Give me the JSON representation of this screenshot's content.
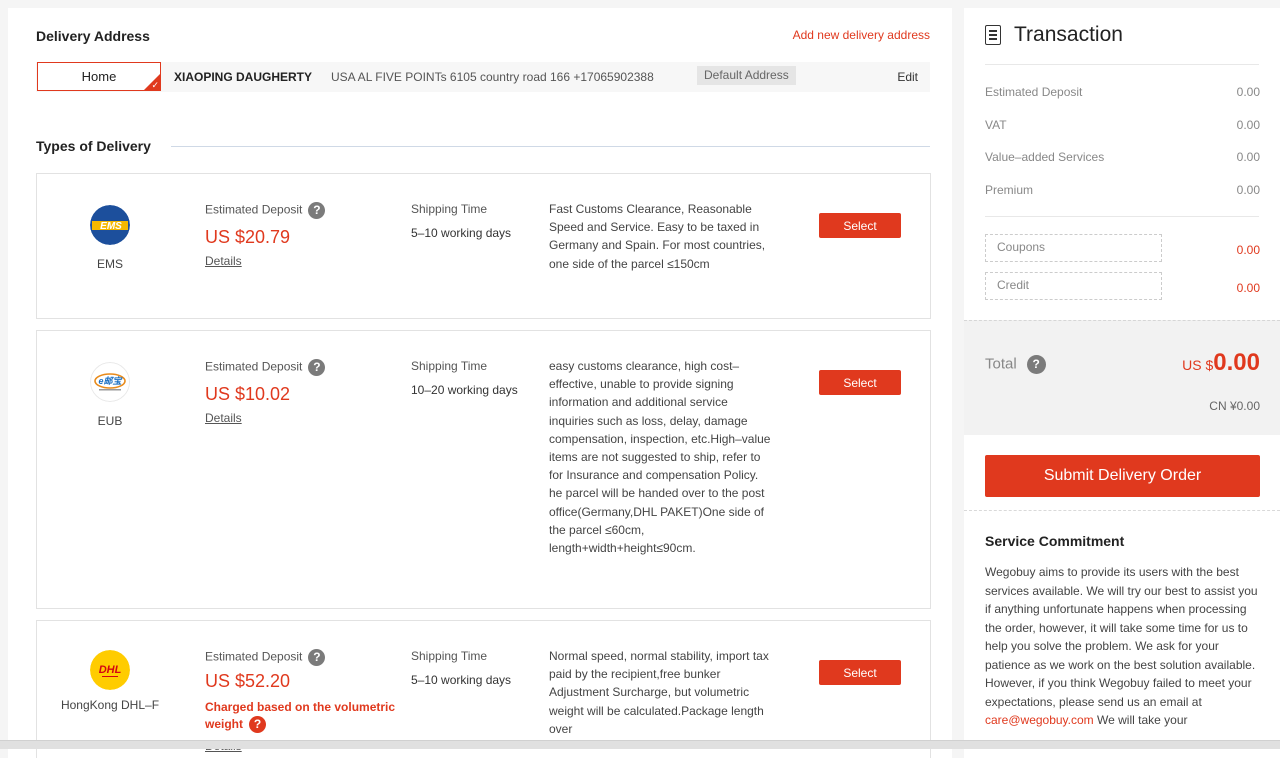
{
  "delivery_address": {
    "title": "Delivery Address",
    "add_link": "Add new delivery address",
    "tag": "Home",
    "name": "XIAOPING DAUGHERTY",
    "address": "USA AL FIVE POINTs 6105 country road 166 +17065902388",
    "badge": "Default Address",
    "edit": "Edit"
  },
  "types_title": "Types of Delivery",
  "deposit_label": "Estimated Deposit",
  "shipping_label": "Shipping Time",
  "details_label": "Details",
  "select_label": "Select",
  "options": [
    {
      "logo_icon": "ems-logo-icon",
      "name": "EMS",
      "price": "US $20.79",
      "time": "5–10 working days",
      "desc": "Fast Customs Clearance, Reasonable Speed and Service. Easy to be taxed in Germany and Spain. For most countries, one side of the parcel ≤150cm"
    },
    {
      "logo_icon": "eub-logo-icon",
      "name": "EUB",
      "price": "US $10.02",
      "time": "10–20 working days",
      "desc": "easy customs clearance, high cost–effective, unable to provide signing information and additional service inquiries such as loss, delay, damage compensation, inspection, etc.High–value items are not suggested to ship, refer to for Insurance and compensation Policy. he parcel will be handed over to the post office(Germany,DHL PAKET)One side of the parcel ≤60cm, length+width+height≤90cm."
    },
    {
      "logo_icon": "dhl-logo-icon",
      "name": "HongKong DHL–F",
      "price": "US $52.20",
      "time": "5–10 working days",
      "note": "Charged based on the volumetric weight",
      "desc": "Normal speed, normal stability, import tax paid by the recipient,free bunker Adjustment Surcharge, but volumetric weight will be calculated.Package length over"
    }
  ],
  "transaction": {
    "title": "Transaction",
    "rows": [
      {
        "label": "Estimated Deposit",
        "value": "0.00"
      },
      {
        "label": "VAT",
        "value": "0.00"
      },
      {
        "label": "Value–added Services",
        "value": "0.00"
      },
      {
        "label": "Premium",
        "value": "0.00"
      }
    ],
    "coupons_label": "Coupons",
    "coupons_value": "0.00",
    "credit_label": "Credit",
    "credit_value": "0.00",
    "total_label": "Total",
    "total_currency": "US $",
    "total_amount": "0.00",
    "total_cny": "CN ¥0.00",
    "submit_label": "Submit Delivery Order"
  },
  "service": {
    "title": "Service Commitment",
    "text": "Wegobuy aims to provide its users with the best services available. We will try our best to assist you if anything unfortunate happens when processing the order, however, it will take some time for us to help you solve the problem. We ask for your patience as we work on the best solution available. However, if you think Wegobuy failed to meet your expectations, please send us an email at",
    "email": "care@wegobuy.com",
    "text_after": " We will take your"
  },
  "colors": {
    "accent": "#e0391e"
  }
}
